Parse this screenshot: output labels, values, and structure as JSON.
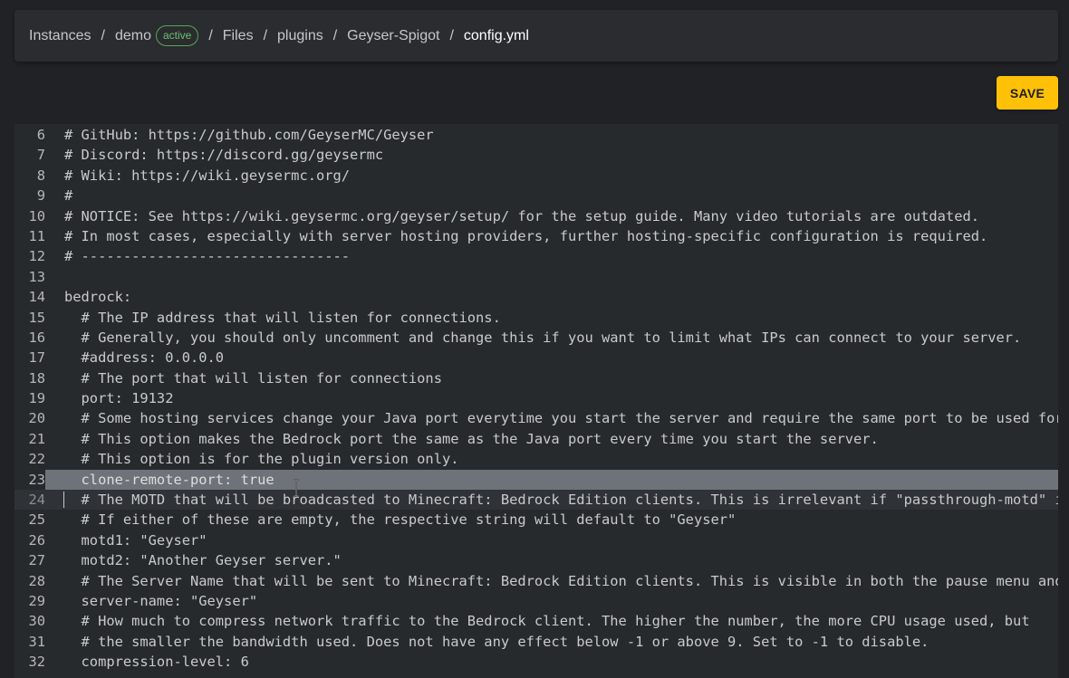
{
  "breadcrumb": {
    "items": [
      "Instances",
      "demo",
      "Files",
      "plugins",
      "Geyser-Spigot",
      "config.yml"
    ],
    "separator": "/",
    "badge": "active"
  },
  "toolbar": {
    "save_label": "SAVE"
  },
  "editor": {
    "selected_line": 23,
    "active_line": 24,
    "lines": [
      {
        "num": "6",
        "text": "# GitHub: https://github.com/GeyserMC/Geyser"
      },
      {
        "num": "7",
        "text": "# Discord: https://discord.gg/geysermc"
      },
      {
        "num": "8",
        "text": "# Wiki: https://wiki.geysermc.org/"
      },
      {
        "num": "9",
        "text": "#"
      },
      {
        "num": "10",
        "text": "# NOTICE: See https://wiki.geysermc.org/geyser/setup/ for the setup guide. Many video tutorials are outdated."
      },
      {
        "num": "11",
        "text": "# In most cases, especially with server hosting providers, further hosting-specific configuration is required."
      },
      {
        "num": "12",
        "text": "# --------------------------------"
      },
      {
        "num": "13",
        "text": ""
      },
      {
        "num": "14",
        "text": "bedrock:"
      },
      {
        "num": "15",
        "text": "  # The IP address that will listen for connections."
      },
      {
        "num": "16",
        "text": "  # Generally, you should only uncomment and change this if you want to limit what IPs can connect to your server."
      },
      {
        "num": "17",
        "text": "  #address: 0.0.0.0"
      },
      {
        "num": "18",
        "text": "  # The port that will listen for connections"
      },
      {
        "num": "19",
        "text": "  port: 19132"
      },
      {
        "num": "20",
        "text": "  # Some hosting services change your Java port everytime you start the server and require the same port to be used for Bedrock."
      },
      {
        "num": "21",
        "text": "  # This option makes the Bedrock port the same as the Java port every time you start the server."
      },
      {
        "num": "22",
        "text": "  # This option is for the plugin version only."
      },
      {
        "num": "23",
        "text": "  clone-remote-port: true"
      },
      {
        "num": "24",
        "text": "  # The MOTD that will be broadcasted to Minecraft: Bedrock Edition clients. This is irrelevant if \"passthrough-motd\" is set to true"
      },
      {
        "num": "25",
        "text": "  # If either of these are empty, the respective string will default to \"Geyser\""
      },
      {
        "num": "26",
        "text": "  motd1: \"Geyser\""
      },
      {
        "num": "27",
        "text": "  motd2: \"Another Geyser server.\""
      },
      {
        "num": "28",
        "text": "  # The Server Name that will be sent to Minecraft: Bedrock Edition clients. This is visible in both the pause menu and the settings menu."
      },
      {
        "num": "29",
        "text": "  server-name: \"Geyser\""
      },
      {
        "num": "30",
        "text": "  # How much to compress network traffic to the Bedrock client. The higher the number, the more CPU usage used, but"
      },
      {
        "num": "31",
        "text": "  # the smaller the bandwidth used. Does not have any effect below -1 or above 9. Set to -1 to disable."
      },
      {
        "num": "32",
        "text": "  compression-level: 6"
      }
    ]
  }
}
